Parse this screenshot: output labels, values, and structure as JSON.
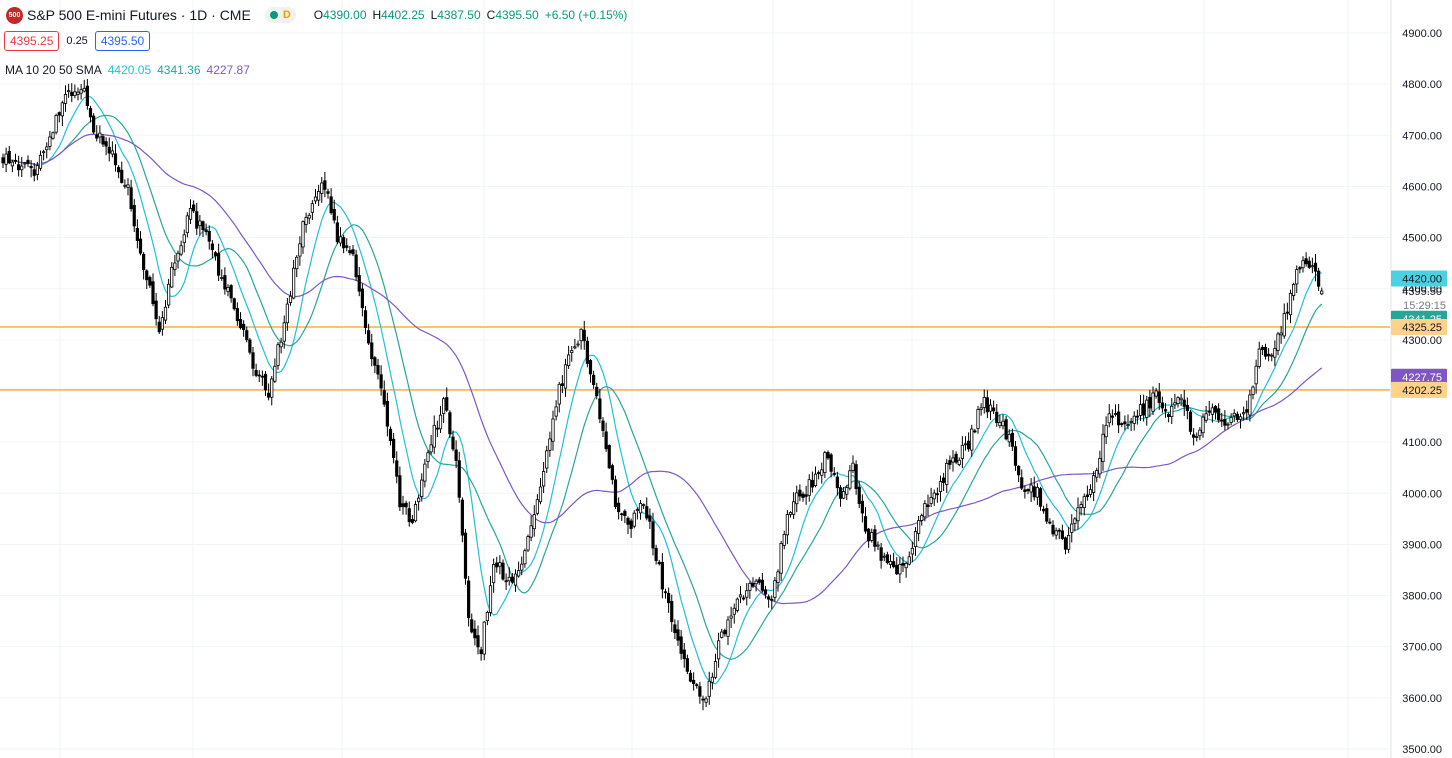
{
  "header": {
    "logo_text": "500",
    "title": "S&P 500 E-mini Futures · 1D · CME",
    "status_badge": "D",
    "ohlc": {
      "open_label": "O",
      "open": "4390.00",
      "high_label": "H",
      "high": "4402.25",
      "low_label": "L",
      "low": "4387.50",
      "close_label": "C",
      "close": "4395.50",
      "change": "+6.50 (+0.15%)"
    },
    "bid": "4395.25",
    "spread": "0.25",
    "ask": "4395.50"
  },
  "indicator": {
    "label": "MA 10 20 50 SMA",
    "ma10": "4420.05",
    "ma20": "4341.36",
    "ma50": "4227.87"
  },
  "colors": {
    "up": "#089981",
    "down": "#f23645",
    "candle": "#000000",
    "ma10": "#22c1d6",
    "ma20": "#26a69a",
    "ma50": "#7e57c2",
    "hline": "#f7b23b",
    "grid": "#f0f3fa",
    "axis_text": "#131722"
  },
  "chart_data": {
    "type": "candlestick",
    "symbol": "S&P 500 E-mini Futures",
    "interval": "1D",
    "ylim": [
      3500,
      4950
    ],
    "y_ticks": [
      "4900.00",
      "4800.00",
      "4700.00",
      "4600.00",
      "4500.00",
      "4400.00",
      "4300.00",
      "4200.00",
      "4100.00",
      "4000.00",
      "3900.00",
      "3800.00",
      "3700.00",
      "3600.00",
      "3500.00"
    ],
    "grid": true,
    "close_anchors": [
      [
        0,
        4660
      ],
      [
        5,
        4640
      ],
      [
        10,
        4630
      ],
      [
        15,
        4700
      ],
      [
        20,
        4780
      ],
      [
        25,
        4800
      ],
      [
        30,
        4700
      ],
      [
        35,
        4660
      ],
      [
        40,
        4590
      ],
      [
        45,
        4450
      ],
      [
        50,
        4320
      ],
      [
        55,
        4460
      ],
      [
        60,
        4550
      ],
      [
        65,
        4500
      ],
      [
        70,
        4420
      ],
      [
        75,
        4350
      ],
      [
        80,
        4250
      ],
      [
        85,
        4200
      ],
      [
        90,
        4330
      ],
      [
        95,
        4500
      ],
      [
        100,
        4590
      ],
      [
        103,
        4600
      ],
      [
        107,
        4500
      ],
      [
        112,
        4460
      ],
      [
        117,
        4290
      ],
      [
        122,
        4180
      ],
      [
        127,
        3980
      ],
      [
        131,
        3950
      ],
      [
        136,
        4080
      ],
      [
        141,
        4180
      ],
      [
        145,
        4060
      ],
      [
        149,
        3760
      ],
      [
        153,
        3690
      ],
      [
        157,
        3870
      ],
      [
        163,
        3820
      ],
      [
        167,
        3880
      ],
      [
        172,
        4000
      ],
      [
        177,
        4180
      ],
      [
        182,
        4280
      ],
      [
        185,
        4310
      ],
      [
        188,
        4240
      ],
      [
        192,
        4130
      ],
      [
        196,
        3980
      ],
      [
        200,
        3930
      ],
      [
        205,
        3990
      ],
      [
        210,
        3850
      ],
      [
        215,
        3730
      ],
      [
        220,
        3620
      ],
      [
        225,
        3600
      ],
      [
        229,
        3700
      ],
      [
        233,
        3760
      ],
      [
        237,
        3800
      ],
      [
        242,
        3830
      ],
      [
        246,
        3780
      ],
      [
        251,
        3970
      ],
      [
        256,
        4000
      ],
      [
        260,
        4030
      ],
      [
        264,
        4080
      ],
      [
        268,
        3980
      ],
      [
        272,
        4050
      ],
      [
        276,
        3930
      ],
      [
        281,
        3880
      ],
      [
        286,
        3850
      ],
      [
        290,
        3880
      ],
      [
        295,
        3970
      ],
      [
        299,
        4010
      ],
      [
        304,
        4070
      ],
      [
        309,
        4090
      ],
      [
        313,
        4180
      ],
      [
        318,
        4150
      ],
      [
        322,
        4110
      ],
      [
        326,
        4020
      ],
      [
        331,
        4000
      ],
      [
        335,
        3940
      ],
      [
        340,
        3900
      ],
      [
        344,
        3960
      ],
      [
        349,
        4030
      ],
      [
        354,
        4150
      ],
      [
        359,
        4130
      ],
      [
        364,
        4160
      ],
      [
        369,
        4190
      ],
      [
        373,
        4160
      ],
      [
        377,
        4190
      ],
      [
        381,
        4110
      ],
      [
        386,
        4170
      ],
      [
        390,
        4130
      ],
      [
        394,
        4150
      ],
      [
        398,
        4150
      ],
      [
        402,
        4270
      ],
      [
        406,
        4280
      ],
      [
        410,
        4340
      ],
      [
        414,
        4440
      ],
      [
        418,
        4450
      ],
      [
        422,
        4395.5
      ]
    ],
    "last_index": 422,
    "price_lines": [
      4325.25,
      4202.25
    ],
    "axis_labels": [
      {
        "text": "4420.00",
        "value": 4420,
        "color": "#4dd0e1",
        "text_color": "#131722"
      },
      {
        "text": "4341.25",
        "value": 4341.25,
        "color": "#26a69a",
        "text_color": "#ffffff"
      },
      {
        "text": "4325.25",
        "value": 4325.25,
        "color": "#ffd18a",
        "text_color": "#131722"
      },
      {
        "text": "4227.75",
        "value": 4227.75,
        "color": "#7e57c2",
        "text_color": "#ffffff"
      },
      {
        "text": "4202.25",
        "value": 4202.25,
        "color": "#ffd18a",
        "text_color": "#131722"
      }
    ],
    "last_price": {
      "text": "4395.50",
      "value": 4395.5
    },
    "countdown": "15:29:15",
    "series": [
      {
        "name": "MA 10",
        "period": 10,
        "value_shown": "4420.05"
      },
      {
        "name": "MA 20",
        "period": 20,
        "value_shown": "4341.36"
      },
      {
        "name": "MA 50",
        "period": 50,
        "value_shown": "4227.87"
      }
    ]
  }
}
